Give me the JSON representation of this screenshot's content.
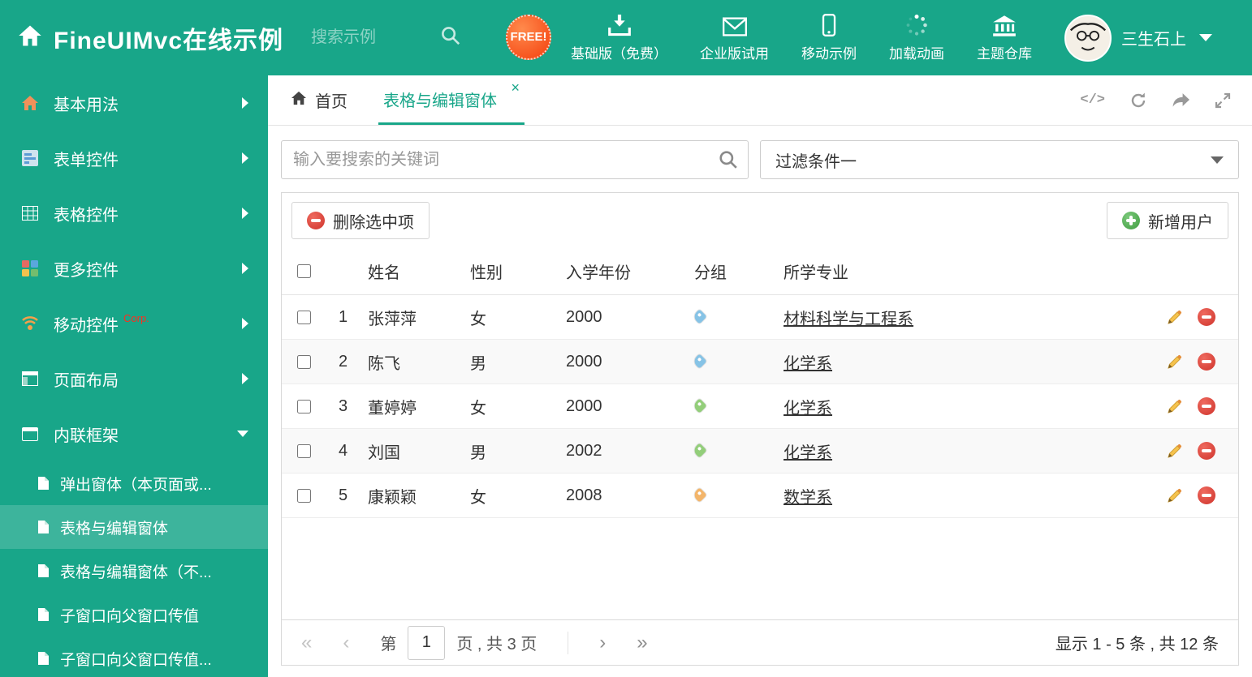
{
  "colors": {
    "teal": "#18A689",
    "red": "#D9534F",
    "green": "#5CB85C",
    "gold": "#F6C34D",
    "free_orange": "#F4400E"
  },
  "icons": {
    "close": "×",
    "first": "«",
    "prev": "‹",
    "next": "›",
    "last": "»",
    "code": "</>"
  },
  "header": {
    "title": "FineUIMvc在线示例",
    "search_placeholder": "搜索示例",
    "free_badge": "FREE!",
    "nav": [
      {
        "label": "基础版（免费）",
        "icon": "download-icon"
      },
      {
        "label": "企业版试用",
        "icon": "mail-icon"
      },
      {
        "label": "移动示例",
        "icon": "mobile-icon"
      },
      {
        "label": "加载动画",
        "icon": "loading-icon"
      },
      {
        "label": "主题仓库",
        "icon": "bank-icon"
      }
    ],
    "user": {
      "name": "三生石上"
    }
  },
  "sidebar": {
    "items": [
      {
        "label": "基本用法"
      },
      {
        "label": "表单控件"
      },
      {
        "label": "表格控件"
      },
      {
        "label": "更多控件"
      },
      {
        "label": "移动控件",
        "badge": "Corp."
      },
      {
        "label": "页面布局"
      },
      {
        "label": "内联框架"
      }
    ],
    "subitems": [
      {
        "label": "弹出窗体（本页面或..."
      },
      {
        "label": "表格与编辑窗体"
      },
      {
        "label": "表格与编辑窗体（不..."
      },
      {
        "label": "子窗口向父窗口传值"
      },
      {
        "label": "子窗口向父窗口传值..."
      }
    ]
  },
  "tabs": {
    "home": "首页",
    "active": "表格与编辑窗体"
  },
  "filter": {
    "search_placeholder": "输入要搜索的关键词",
    "dropdown_value": "过滤条件一"
  },
  "toolbar": {
    "delete_label": "删除选中项",
    "add_label": "新增用户"
  },
  "table": {
    "headers": [
      "姓名",
      "性别",
      "入学年份",
      "分组",
      "所学专业"
    ],
    "rows": [
      {
        "num": "1",
        "name": "张萍萍",
        "gender": "女",
        "year": "2000",
        "tag_color": "#86C3E6",
        "major": "材料科学与工程系"
      },
      {
        "num": "2",
        "name": "陈飞",
        "gender": "男",
        "year": "2000",
        "tag_color": "#86C3E6",
        "major": "化学系"
      },
      {
        "num": "3",
        "name": "董婷婷",
        "gender": "女",
        "year": "2000",
        "tag_color": "#93CE7A",
        "major": "化学系"
      },
      {
        "num": "4",
        "name": "刘国",
        "gender": "男",
        "year": "2002",
        "tag_color": "#93CE7A",
        "major": "化学系"
      },
      {
        "num": "5",
        "name": "康颖颖",
        "gender": "女",
        "year": "2008",
        "tag_color": "#F3B56A",
        "major": "数学系"
      }
    ]
  },
  "pagination": {
    "page_prefix": "第",
    "current_page": "1",
    "page_suffix": "页 , 共 3 页",
    "summary": "显示 1 - 5 条 , 共 12 条"
  }
}
